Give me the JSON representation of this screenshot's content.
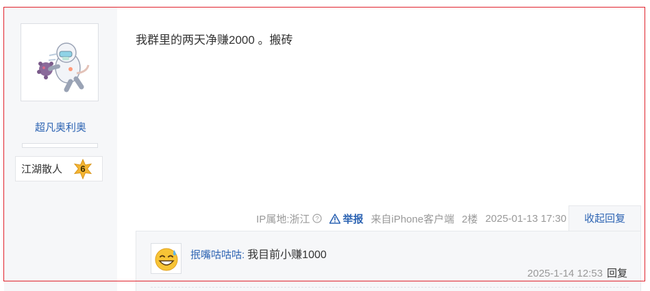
{
  "author": {
    "name": "超凡奥利奥",
    "level_title": "江湖散人",
    "level_number": "6",
    "avatar_icon": "astronaut-sticker-avatar-icon"
  },
  "post": {
    "content": "我群里的两天净赚2000 。搬砖",
    "ip_location": "IP属地:浙江",
    "report_label": "举报",
    "source": "来自iPhone客户端",
    "floor": "2楼",
    "timestamp": "2025-01-13 17:30",
    "collapse_reply_label": "收起回复"
  },
  "reply": {
    "user": "抿嘴咕咕咕:",
    "text": "我目前小赚1000",
    "timestamp": "2025-1-14 12:53",
    "reply_label": "回复",
    "avatar_icon": "sweat-smile-emoji-icon"
  },
  "colors": {
    "link_blue": "#2d64b3",
    "frame_red": "#e0202a",
    "meta_gray": "#999999",
    "panel_bg": "#f6f7f9"
  }
}
